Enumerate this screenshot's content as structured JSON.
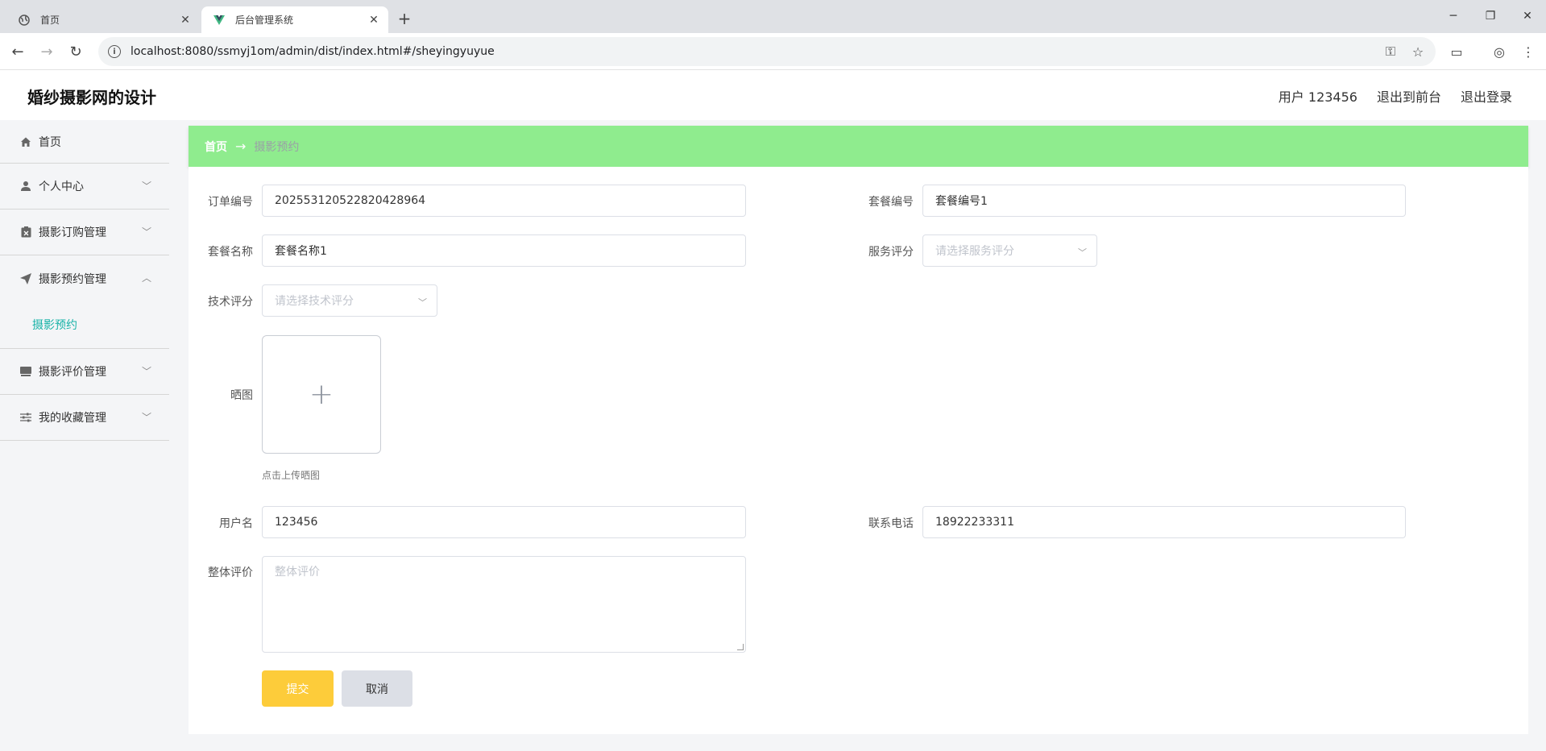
{
  "browser": {
    "tabs": [
      {
        "title": "首页",
        "icon": "globe-icon",
        "active": false
      },
      {
        "title": "后台管理系统",
        "icon": "vue-logo-icon",
        "active": true
      }
    ],
    "new_tab_glyph": "+",
    "address": "localhost:8080/ssmyj1om/admin/dist/index.html#/sheyingyuyue"
  },
  "header": {
    "title": "婚纱摄影网的设计",
    "user_label": "用户 123456",
    "front_link": "退出到前台",
    "logout_link": "退出登录"
  },
  "sidebar": {
    "items": [
      {
        "label": "首页",
        "icon": "home-icon"
      },
      {
        "label": "个人中心",
        "icon": "user-icon"
      },
      {
        "label": "摄影订购管理",
        "icon": "clipboard-icon"
      },
      {
        "label": "摄影预约管理",
        "icon": "send-icon"
      },
      {
        "label": "摄影评价管理",
        "icon": "folder-icon"
      },
      {
        "label": "我的收藏管理",
        "icon": "sliders-icon"
      }
    ],
    "active_sub": "摄影预约"
  },
  "breadcrumb": {
    "home": "首页",
    "arrow": "→",
    "current": "摄影预约"
  },
  "form": {
    "order_no": {
      "label": "订单编号",
      "value": "2025531205228204289​64"
    },
    "package_no": {
      "label": "套餐编号",
      "value": "套餐编号1"
    },
    "package_name": {
      "label": "套餐名称",
      "value": "套餐名称1"
    },
    "service_rating": {
      "label": "服务评分",
      "placeholder": "请选择服务评分"
    },
    "tech_rating": {
      "label": "技术评分",
      "placeholder": "请选择技术评分"
    },
    "photo": {
      "label": "晒图",
      "tip": "点击上传晒图",
      "glyph": "+"
    },
    "username": {
      "label": "用户名",
      "value": "123456"
    },
    "phone": {
      "label": "联系电话",
      "value": "18922233311"
    },
    "overall": {
      "label": "整体评价",
      "placeholder": "整体评价"
    },
    "submit": "提交",
    "cancel": "取消"
  },
  "colors": {
    "breadcrumb_bg": "#8fec8e",
    "submit_bg": "#fdcc3a",
    "active_sub": "#19b3a8"
  }
}
